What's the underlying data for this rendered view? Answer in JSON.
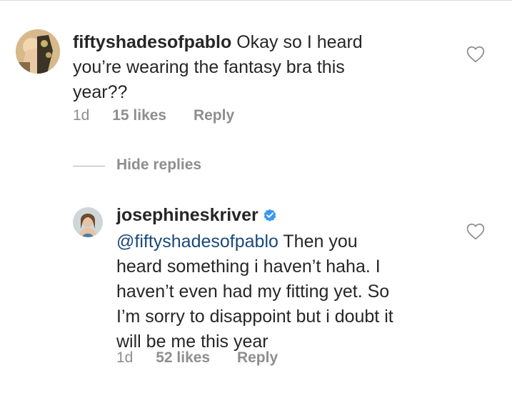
{
  "comment": {
    "username": "fiftyshadesofpablo",
    "text_line1": " Okay so I heard",
    "text_line2": "you’re wearing the fantasy bra this",
    "text_line3": "year??",
    "time": "1d",
    "likes": "15 likes",
    "reply_label": "Reply"
  },
  "replies_toggle": {
    "label": "Hide replies"
  },
  "reply": {
    "username": "josephineskriver",
    "verified": true,
    "mention": "@fiftyshadesofpablo",
    "text_line1": " Then you",
    "text_line2": "heard something i haven’t haha. I",
    "text_line3": "haven’t even had my fitting yet. So",
    "text_line4": "I’m sorry to disappoint but i doubt it",
    "text_line5": "will be me this year",
    "time": "1d",
    "likes": "52 likes",
    "reply_label": "Reply"
  },
  "colors": {
    "text": "#262626",
    "meta": "#8e8e8e",
    "verified_badge": "#3897f0"
  }
}
